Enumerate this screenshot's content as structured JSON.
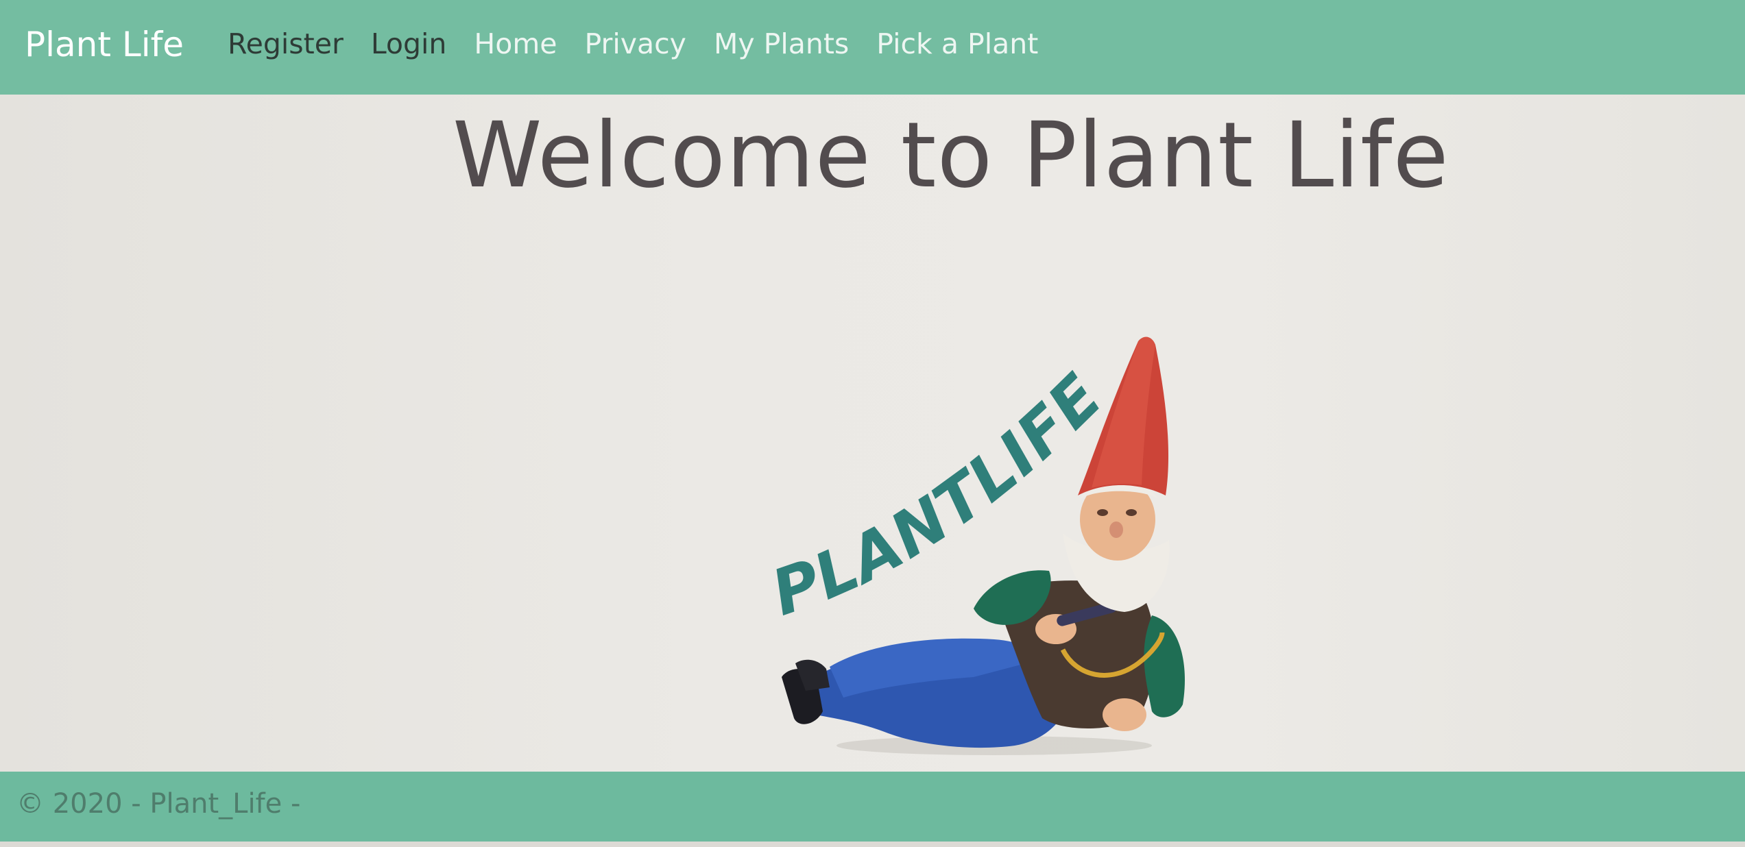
{
  "nav": {
    "brand": "Plant Life",
    "links": [
      {
        "label": "Register",
        "style": "dark"
      },
      {
        "label": "Login",
        "style": "dark"
      },
      {
        "label": "Home",
        "style": "light"
      },
      {
        "label": "Privacy",
        "style": "light"
      },
      {
        "label": "My Plants",
        "style": "light"
      },
      {
        "label": "Pick a Plant",
        "style": "light"
      }
    ]
  },
  "main": {
    "headline": "Welcome to Plant Life",
    "logo": {
      "text": "PLANTLIFE",
      "icon": "garden-gnome-illustration"
    }
  },
  "footer": {
    "text": "© 2020 - Plant_Life -"
  },
  "colors": {
    "navbar": "#74bda1",
    "footer": "#6dba9e",
    "logo_text": "#2f7f7a",
    "headline": "#524c4e"
  }
}
